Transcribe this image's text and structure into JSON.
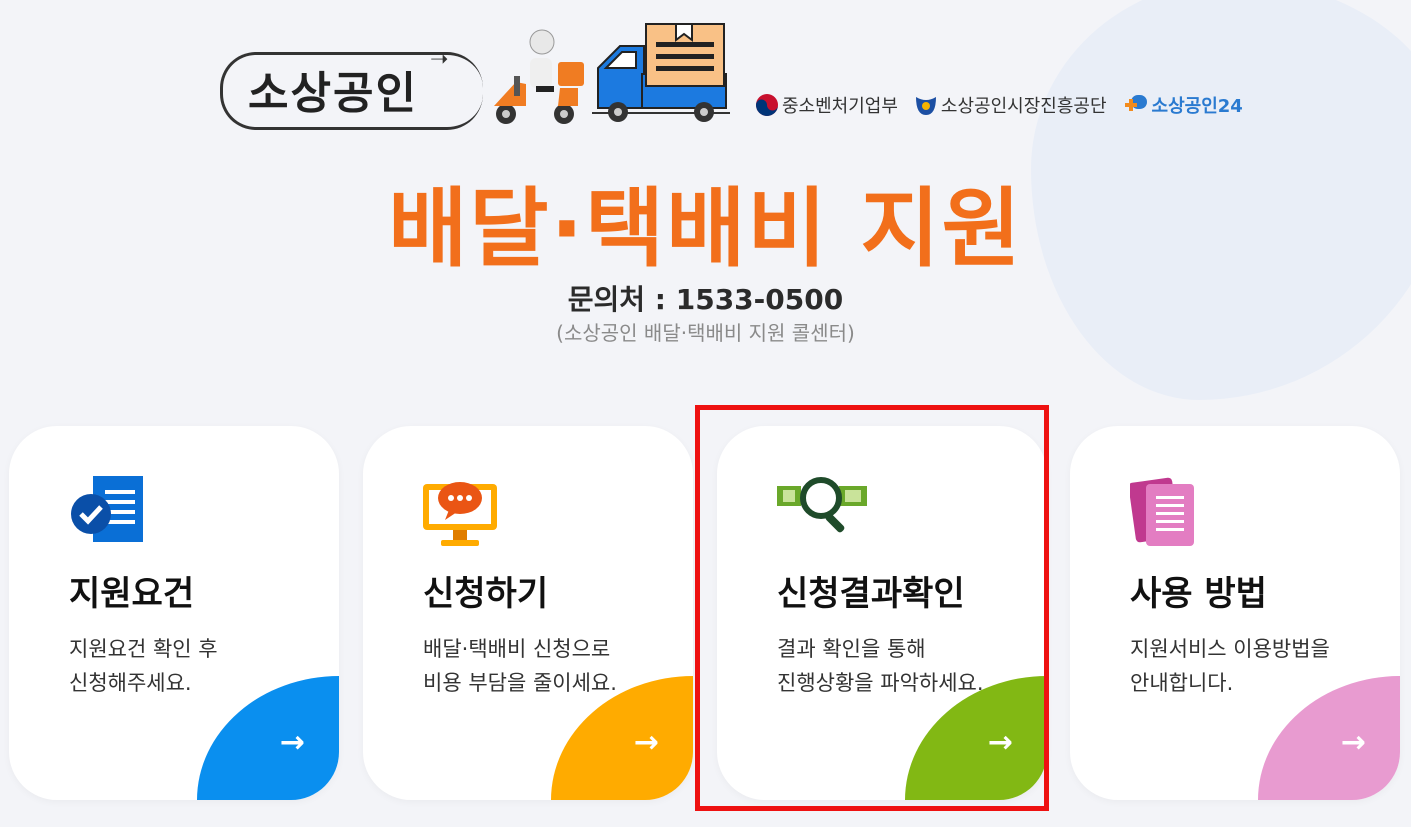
{
  "header": {
    "banner_title": "소상공인",
    "logos": [
      {
        "name": "중소벤처기업부",
        "icon": "ministry-emblem-icon"
      },
      {
        "name": "소상공인시장진흥공단",
        "icon": "semas-logo-icon"
      },
      {
        "name": "소상공인24",
        "icon": "sosang24-logo-icon"
      }
    ]
  },
  "main": {
    "title": "배달·택배비 지원",
    "contact": "문의처 : 1533-0500",
    "contact_sub": "(소상공인 배달·택배비 지원 콜센터)"
  },
  "cards": [
    {
      "title": "지원요건",
      "desc1": "지원요건 확인 후",
      "desc2": "신청해주세요.",
      "icon": "document-check-icon",
      "accent": "#0a8fef",
      "arrow": "→"
    },
    {
      "title": "신청하기",
      "desc1": "배달·택배비 신청으로",
      "desc2": "비용 부담을 줄이세요.",
      "icon": "monitor-chat-icon",
      "accent": "#ffab00",
      "arrow": "→"
    },
    {
      "title": "신청결과확인",
      "desc1": "결과 확인을 통해",
      "desc2": "진행상황을 파악하세요.",
      "icon": "search-magnifier-icon",
      "accent": "#82b814",
      "arrow": "→"
    },
    {
      "title": "사용 방법",
      "desc1": "지원서비스 이용방법을",
      "desc2": "안내합니다.",
      "icon": "documents-stack-icon",
      "accent": "#e89bd0",
      "arrow": "→"
    }
  ],
  "colors": {
    "title_orange": "#f26f1b",
    "highlight_red": "#ee1111"
  }
}
